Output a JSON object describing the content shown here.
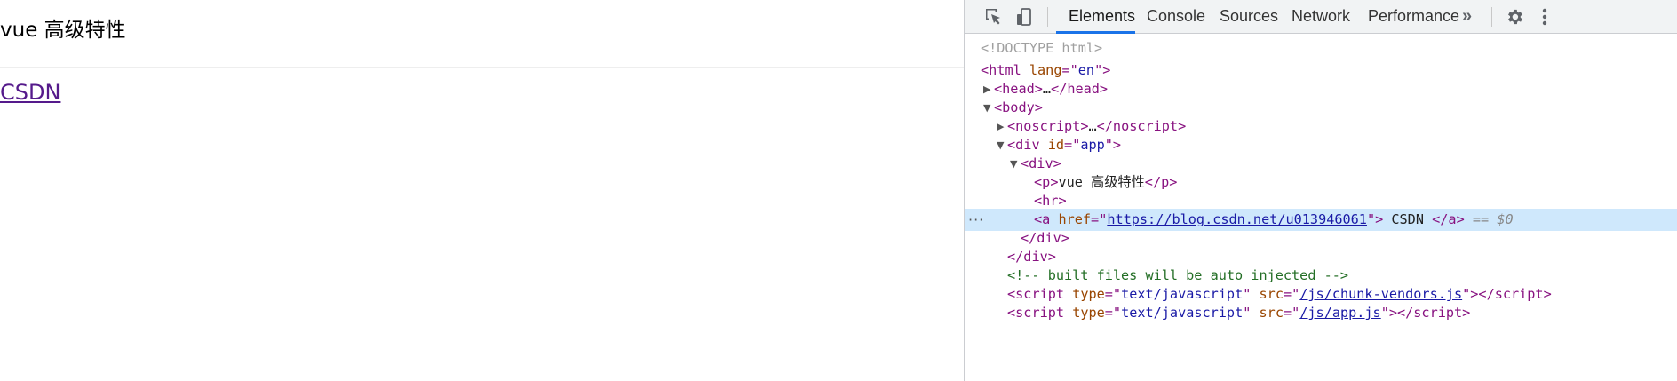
{
  "page": {
    "heading": "vue 高级特性",
    "link_text": "CSDN"
  },
  "devtools": {
    "tabs": [
      "Elements",
      "Console",
      "Sources",
      "Network",
      "Performance"
    ],
    "active_tab": "Elements",
    "overflow_label": "»",
    "icons": [
      "inspect-element-icon",
      "device-toolbar-icon",
      "more-tabs-icon",
      "settings-gear-icon",
      "more-options-kebab-icon"
    ]
  },
  "tree": {
    "doctype": "<!DOCTYPE html>",
    "html_open": "html",
    "html_lang_attr": "lang",
    "html_lang_val": "en",
    "head": "head",
    "head_ellipsis": "…",
    "body": "body",
    "noscript": "noscript",
    "div": "div",
    "div_id_attr": "id",
    "div_id_val": "app",
    "p": "p",
    "p_text": "vue 高级特性",
    "hr": "hr",
    "a": "a",
    "a_href_attr": "href",
    "a_href_val": "https://blog.csdn.net/u013946061",
    "a_text": " CSDN ",
    "selected_marker": "== $0",
    "comment": "<!-- built files will be auto injected -->",
    "script": "script",
    "script_type_attr": "type",
    "script_type_val": "text/javascript",
    "script_src_attr": "src",
    "script1_src": "/js/chunk-vendors.js",
    "script2_src": "/js/app.js",
    "row_ellipsis": "···"
  },
  "colors": {
    "tag": "#881280",
    "attr": "#994500",
    "value": "#1a1aa6",
    "comment": "#236e25",
    "selection": "#cfe8fc",
    "active_tab_underline": "#1a73e8"
  }
}
